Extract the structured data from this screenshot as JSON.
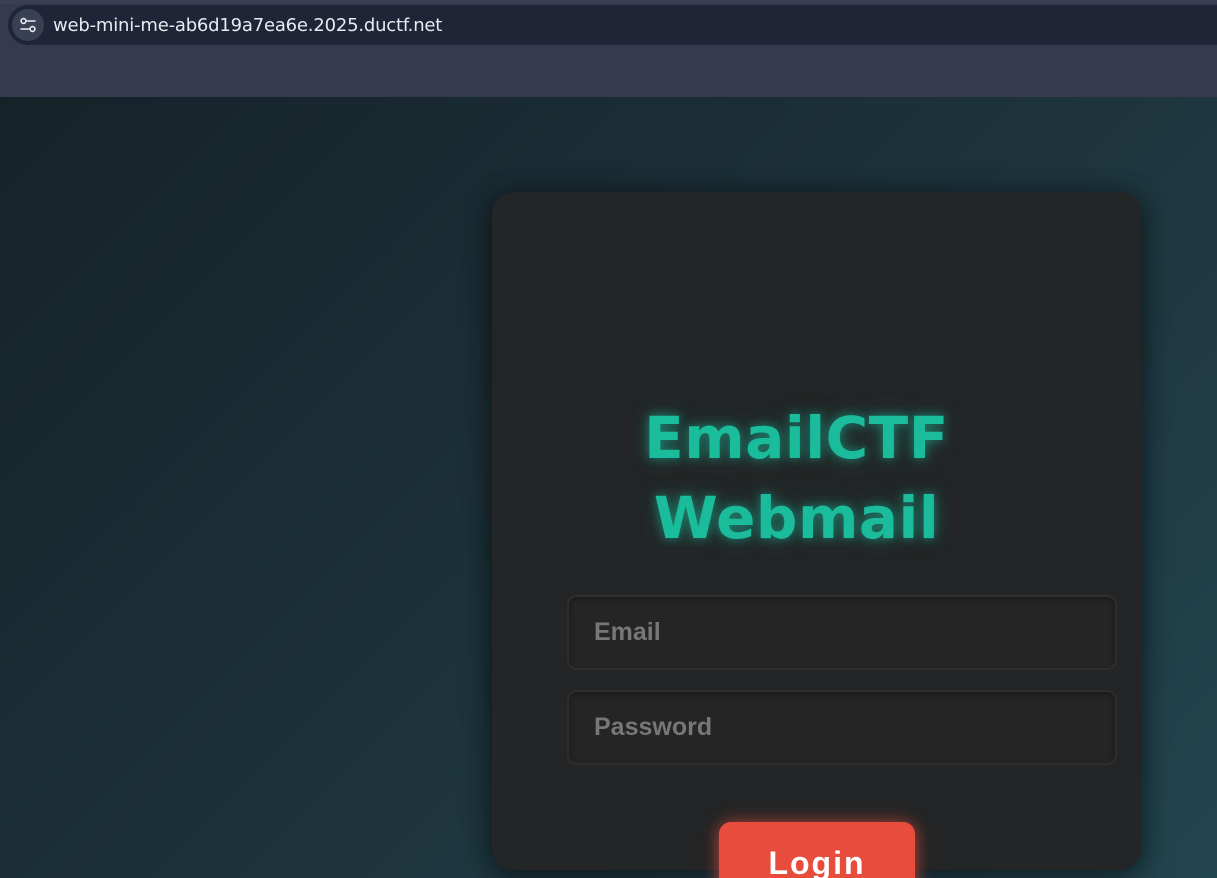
{
  "browser": {
    "url": "web-mini-me-ab6d19a7ea6e.2025.ductf.net",
    "site_info_icon": "tune-sliders-icon"
  },
  "page": {
    "title_line1": "EmailCTF",
    "title_line2": "Webmail",
    "accent_color": "#1abc9c",
    "email_placeholder": "Email",
    "password_placeholder": "Password",
    "login_label": "Login",
    "login_color": "#e74c3c"
  }
}
